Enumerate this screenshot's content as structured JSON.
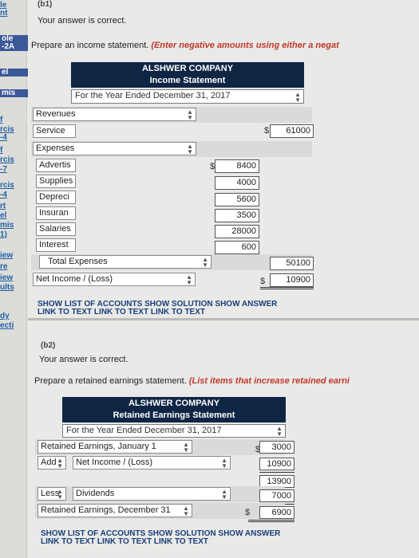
{
  "sidebar": {
    "items": [
      "le",
      "nt",
      "ole",
      "-2A",
      "el",
      "mis",
      "f",
      "rcis",
      "-4",
      "f",
      "rcis",
      "-7",
      "rcis",
      "-4",
      "rt",
      "el",
      "mis",
      "1)",
      "iew",
      "re",
      "iew",
      "ults",
      "dy",
      "ecti"
    ]
  },
  "b1": {
    "label": "(b1)",
    "correct": "Your answer is correct.",
    "instruction_prefix": "Prepare an income statement.",
    "instruction_red": "(Enter negative amounts using either a negat",
    "company": "ALSHWER COMPANY",
    "statement": "Income Statement",
    "period": "For the Year Ended December 31, 2017",
    "revenues_label": "Revenues",
    "service_label": "Service",
    "service_value": "61000",
    "expenses_label": "Expenses",
    "expenses": [
      {
        "name": "Advertis",
        "value": "8400"
      },
      {
        "name": "Supplies",
        "value": "4000"
      },
      {
        "name": "Depreci",
        "value": "5600"
      },
      {
        "name": "Insuran",
        "value": "3500"
      },
      {
        "name": "Salaries",
        "value": "28000"
      },
      {
        "name": "Interest",
        "value": "600"
      }
    ],
    "total_expenses_label": "Total Expenses",
    "total_expenses_value": "50100",
    "net_income_label": "Net Income / (Loss)",
    "net_income_value": "10900",
    "currency": "$",
    "links_line1": "SHOW LIST OF ACCOUNTS  SHOW SOLUTION  SHOW ANSWER",
    "links_line2": "LINK TO TEXT  LINK TO TEXT  LINK TO TEXT"
  },
  "b2": {
    "label": "(b2)",
    "correct": "Your answer is correct.",
    "instruction_prefix": "Prepare a retained earnings statement.",
    "instruction_red": "(List items that increase retained earni",
    "company": "ALSHWER COMPANY",
    "statement": "Retained Earnings Statement",
    "period": "For the Year Ended December 31, 2017",
    "re_jan_label": "Retained Earnings, January 1",
    "re_jan_value": "3000",
    "add_label": "Add",
    "net_income_label": "Net Income / (Loss)",
    "net_income_value": "10900",
    "subtotal_value": "13900",
    "less_label": "Less",
    "dividends_label": "Dividends",
    "dividends_value": "7000",
    "re_dec_label": "Retained Earnings, December 31",
    "re_dec_value": "6900",
    "currency": "$",
    "links_line1": "SHOW LIST OF ACCOUNTS  SHOW SOLUTION  SHOW ANSWER",
    "links_line2": "LINK TO TEXT  LINK TO TEXT  LINK TO TEXT"
  }
}
